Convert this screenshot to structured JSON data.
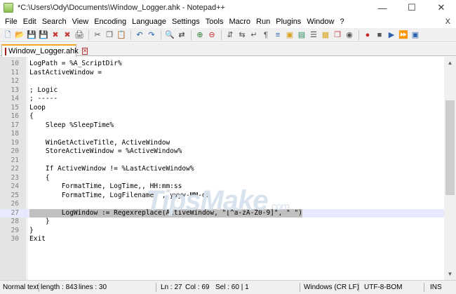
{
  "window": {
    "title": "*C:\\Users\\Ody\\Documents\\Window_Logger.ahk - Notepad++",
    "minimize_glyph": "—",
    "maximize_glyph": "☐",
    "close_glyph": "✕"
  },
  "menu": {
    "items": [
      "File",
      "Edit",
      "Search",
      "View",
      "Encoding",
      "Language",
      "Settings",
      "Tools",
      "Macro",
      "Run",
      "Plugins",
      "Window",
      "?"
    ],
    "close_label": "X"
  },
  "toolbar": {
    "icons": [
      {
        "name": "new-file-icon",
        "glyph": "🗋",
        "color": "#4a7fc1"
      },
      {
        "name": "open-file-icon",
        "glyph": "📂",
        "color": "#d9a521"
      },
      {
        "name": "save-icon",
        "glyph": "💾",
        "color": "#2a5fae"
      },
      {
        "name": "save-all-icon",
        "glyph": "💾",
        "color": "#2a5fae"
      },
      {
        "name": "close-file-icon",
        "glyph": "✖",
        "color": "#c43b3b"
      },
      {
        "name": "close-all-icon",
        "glyph": "✖",
        "color": "#c43b3b"
      },
      {
        "name": "print-icon",
        "glyph": "🖨",
        "color": "#555555"
      },
      {
        "sep": true
      },
      {
        "name": "cut-icon",
        "glyph": "✂",
        "color": "#555555"
      },
      {
        "name": "copy-icon",
        "glyph": "❐",
        "color": "#555555"
      },
      {
        "name": "paste-icon",
        "glyph": "📋",
        "color": "#8a6a2a"
      },
      {
        "sep": true
      },
      {
        "name": "undo-icon",
        "glyph": "↶",
        "color": "#1f5fb0"
      },
      {
        "name": "redo-icon",
        "glyph": "↷",
        "color": "#1f5fb0"
      },
      {
        "sep": true
      },
      {
        "name": "find-icon",
        "glyph": "🔍",
        "color": "#333333"
      },
      {
        "name": "replace-icon",
        "glyph": "⇄",
        "color": "#333333"
      },
      {
        "sep": true
      },
      {
        "name": "zoom-in-icon",
        "glyph": "⊕",
        "color": "#2e7d32"
      },
      {
        "name": "zoom-out-icon",
        "glyph": "⊖",
        "color": "#c62828"
      },
      {
        "sep": true
      },
      {
        "name": "sync-vertical-icon",
        "glyph": "⇵",
        "color": "#555555"
      },
      {
        "name": "sync-horizontal-icon",
        "glyph": "⇆",
        "color": "#555555"
      },
      {
        "name": "word-wrap-icon",
        "glyph": "↵",
        "color": "#555555"
      },
      {
        "name": "show-all-chars-icon",
        "glyph": "¶",
        "color": "#555555"
      },
      {
        "name": "indent-guide-icon",
        "glyph": "≡",
        "color": "#2a5fae"
      },
      {
        "name": "user-language-icon",
        "glyph": "▣",
        "color": "#d9a521"
      },
      {
        "name": "document-map-icon",
        "glyph": "▤",
        "color": "#2a8a5a"
      },
      {
        "name": "function-list-icon",
        "glyph": "☰",
        "color": "#555555"
      },
      {
        "name": "folder-as-workspace-icon",
        "glyph": "▦",
        "color": "#d9a521"
      },
      {
        "name": "document-list-icon",
        "glyph": "❐",
        "color": "#c43b3b"
      },
      {
        "name": "monitoring-icon",
        "glyph": "◉",
        "color": "#555555"
      },
      {
        "sep": true
      },
      {
        "name": "record-macro-icon",
        "glyph": "●",
        "color": "#c62828"
      },
      {
        "name": "stop-recording-icon",
        "glyph": "■",
        "color": "#555555"
      },
      {
        "name": "playback-macro-icon",
        "glyph": "▶",
        "color": "#2a5fae"
      },
      {
        "name": "run-macro-multiple-icon",
        "glyph": "⏩",
        "color": "#2a5fae"
      },
      {
        "name": "save-macro-icon",
        "glyph": "▣",
        "color": "#2a5fae"
      }
    ]
  },
  "tab": {
    "label": "Window_Logger.ahk",
    "close_glyph": "✕"
  },
  "editor": {
    "lines": [
      {
        "n": "10",
        "t": "LogPath = %A_ScriptDir%"
      },
      {
        "n": "11",
        "t": "LastActiveWindow ="
      },
      {
        "n": "12",
        "t": ""
      },
      {
        "n": "13",
        "t": "; Logic"
      },
      {
        "n": "14",
        "t": "; -----"
      },
      {
        "n": "15",
        "t": "Loop"
      },
      {
        "n": "16",
        "t": "{"
      },
      {
        "n": "17",
        "t": "    Sleep %SleepTime%"
      },
      {
        "n": "18",
        "t": ""
      },
      {
        "n": "19",
        "t": "    WinGetActiveTitle, ActiveWindow"
      },
      {
        "n": "20",
        "t": "    StoreActiveWindow = %ActiveWindow%"
      },
      {
        "n": "21",
        "t": ""
      },
      {
        "n": "22",
        "t": "    If ActiveWindow != %LastActiveWindow%"
      },
      {
        "n": "23",
        "t": "    {"
      },
      {
        "n": "24",
        "t": "        FormatTime, LogTime,, HH:mm:ss"
      },
      {
        "n": "25",
        "t": "        FormatTime, LogFilename, , yyyy-MM-dd"
      },
      {
        "n": "26",
        "t": ""
      },
      {
        "n": "27",
        "t": "        LogWindow := Regexreplace(ActiveWindow, \"[^a-zA-Z0-9]\", \" \")",
        "current": true
      },
      {
        "n": "28",
        "t": "    }"
      },
      {
        "n": "29",
        "t": "}"
      },
      {
        "n": "30",
        "t": "Exit"
      }
    ]
  },
  "watermark": {
    "text": "TipsMake",
    "tld": ".com"
  },
  "status": {
    "file_type": "Normal text",
    "length": "length : 843",
    "lines": "lines : 30",
    "ln": "Ln : 27",
    "col": "Col : 69",
    "sel": "Sel : 60 | 1",
    "eol": "Windows (CR LF)",
    "encoding": "UTF-8-BOM",
    "mode": "INS"
  }
}
